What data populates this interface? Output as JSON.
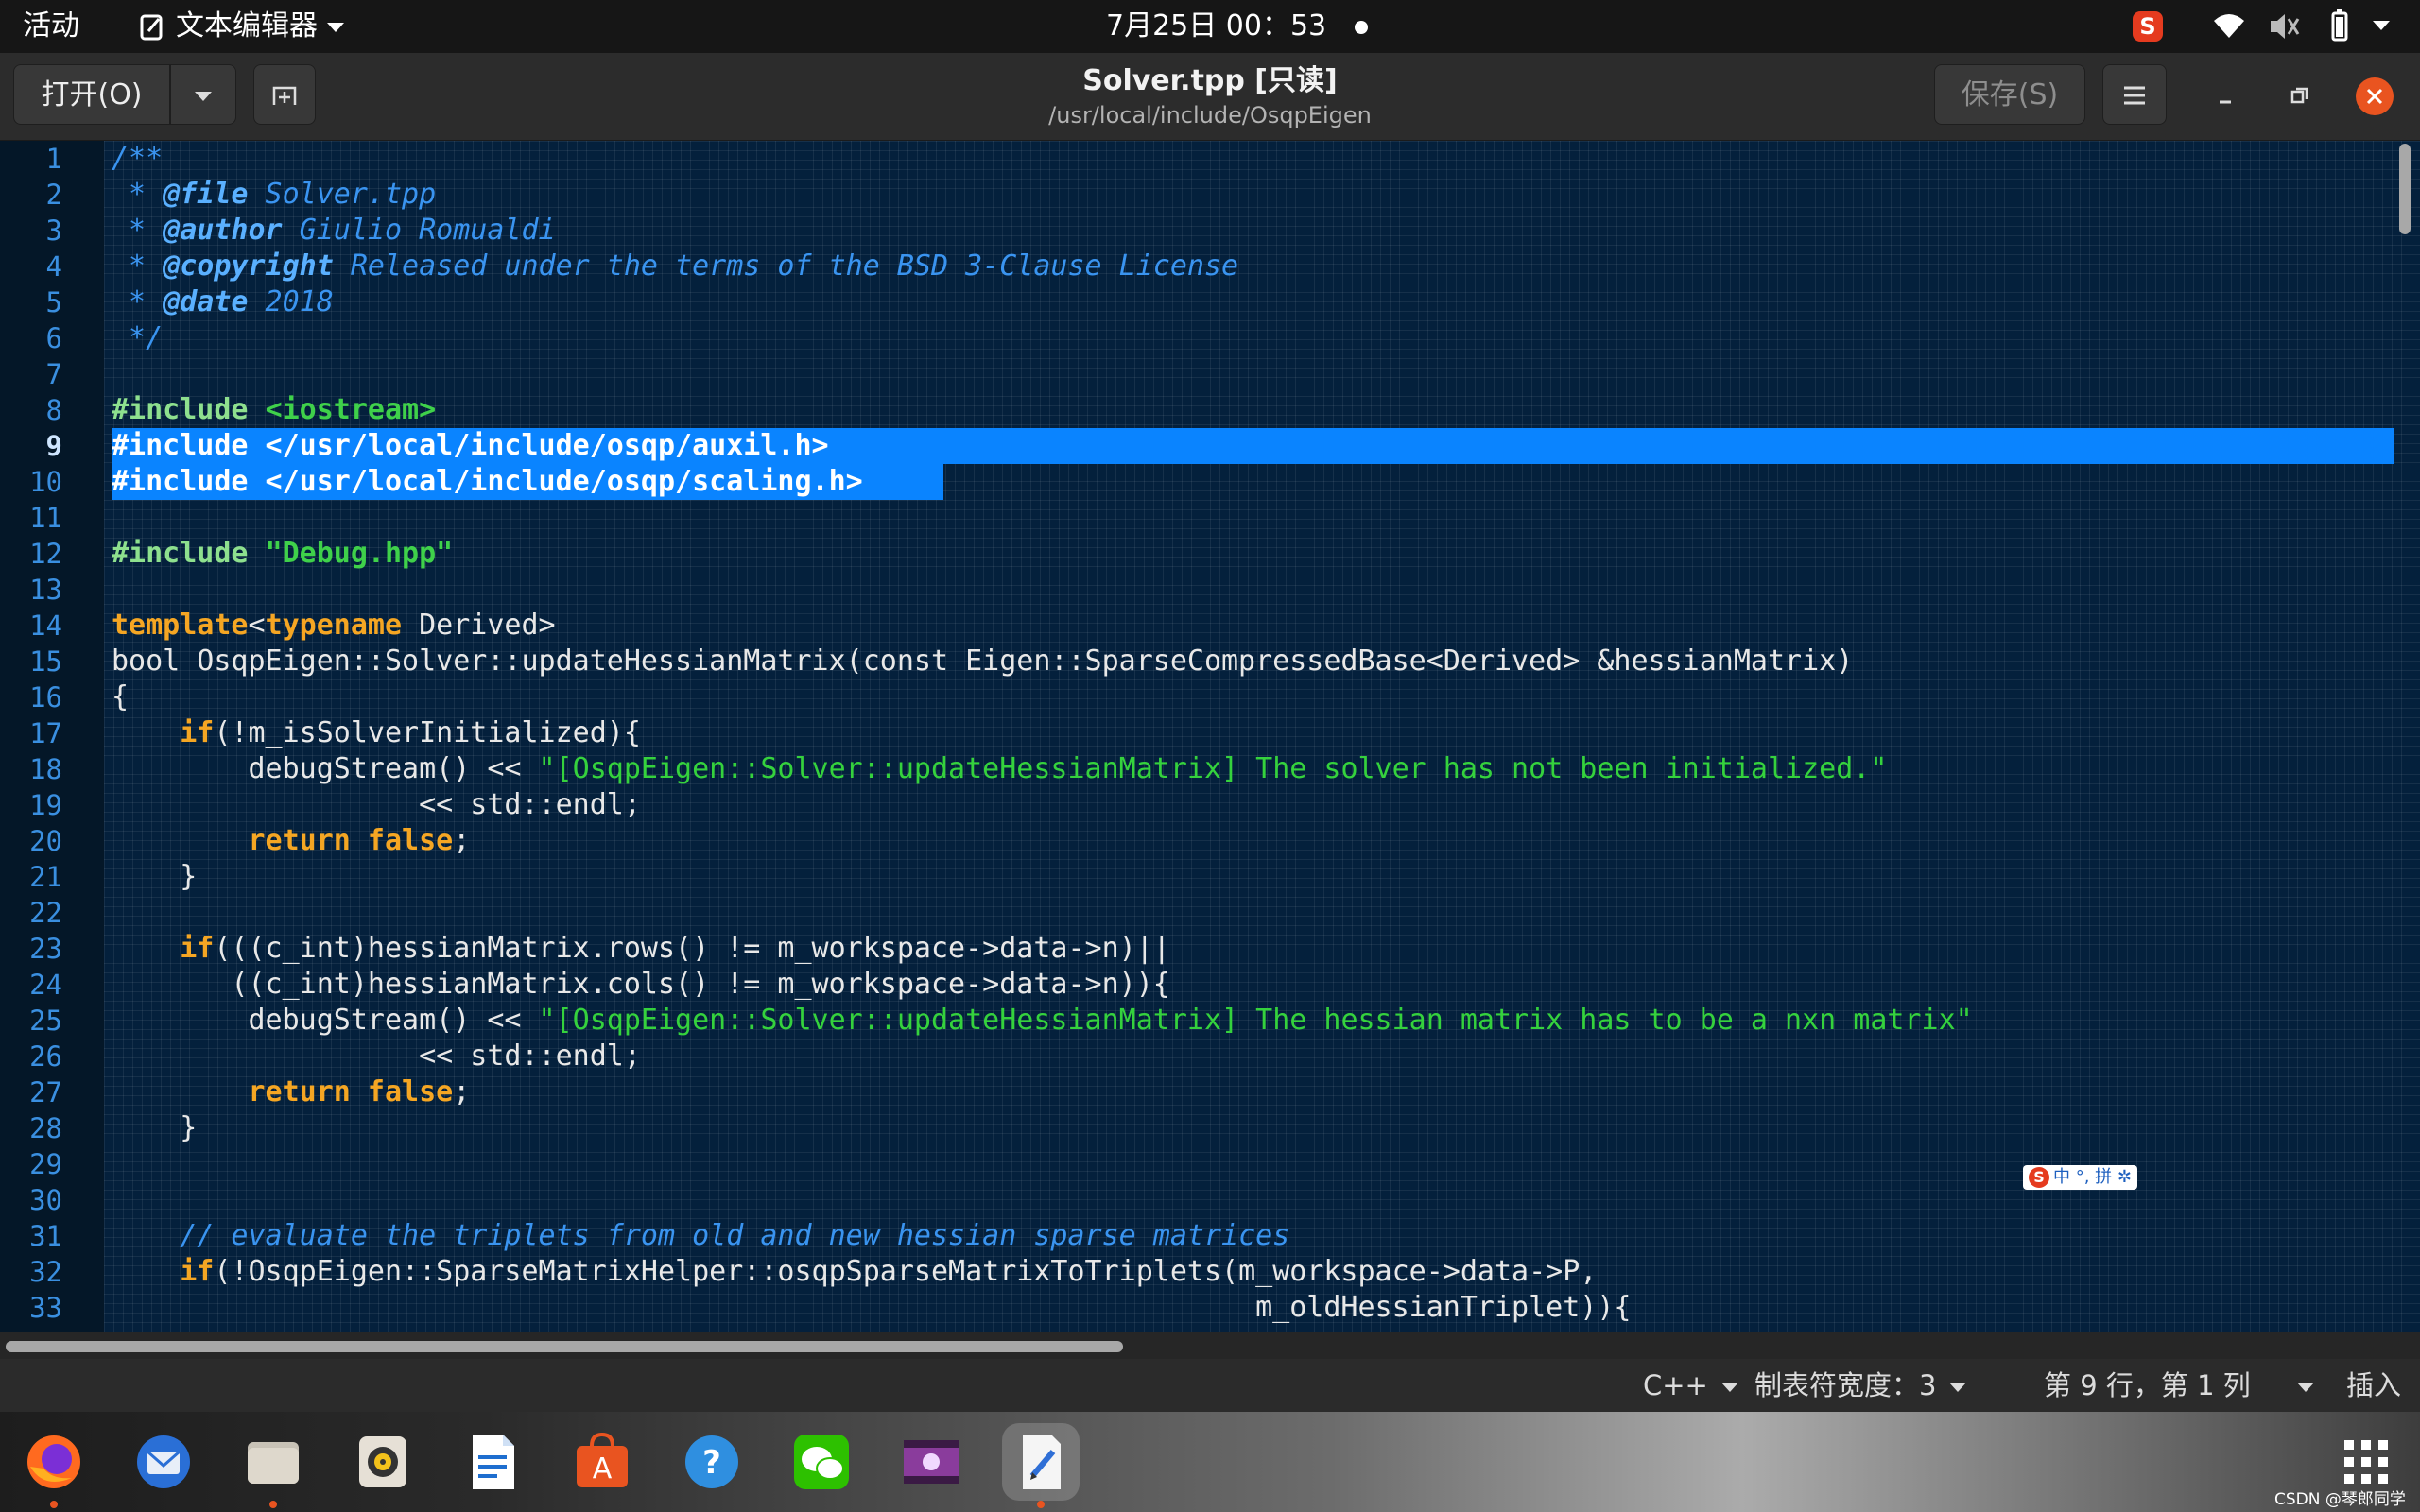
{
  "topbar": {
    "activities": "活动",
    "app_name": "文本编辑器",
    "clock": "7月25日  00：53",
    "ime_icon": "S"
  },
  "header": {
    "open_label": "打开(O)",
    "save_label": "保存(S)",
    "title": "Solver.tpp [只读]",
    "path": "/usr/local/include/OsqpEigen"
  },
  "editor": {
    "current_line": 9,
    "lines": [
      [
        {
          "c": "cm",
          "t": "/**"
        }
      ],
      [
        {
          "c": "cm",
          "t": " * "
        },
        {
          "c": "doctag",
          "t": "@file"
        },
        {
          "c": "cm",
          "t": " Solver.tpp"
        }
      ],
      [
        {
          "c": "cm",
          "t": " * "
        },
        {
          "c": "doctag",
          "t": "@author"
        },
        {
          "c": "cm",
          "t": " Giulio Romualdi"
        }
      ],
      [
        {
          "c": "cm",
          "t": " * "
        },
        {
          "c": "doctag",
          "t": "@copyright"
        },
        {
          "c": "cm",
          "t": " Released under the terms of the BSD 3-Clause License"
        }
      ],
      [
        {
          "c": "cm",
          "t": " * "
        },
        {
          "c": "doctag",
          "t": "@date"
        },
        {
          "c": "cm",
          "t": " 2018"
        }
      ],
      [
        {
          "c": "cm",
          "t": " */"
        }
      ],
      [],
      [
        {
          "c": "pp",
          "t": "#include"
        },
        {
          "c": "",
          "t": " "
        },
        {
          "c": "inc",
          "t": "<iostream>"
        }
      ],
      [
        {
          "c": "sel",
          "t": "#include </usr/local/include/osqp/auxil.h>"
        }
      ],
      [
        {
          "c": "sel",
          "t": "#include </usr/local/include/osqp/scaling.h>"
        }
      ],
      [],
      [
        {
          "c": "pp",
          "t": "#include"
        },
        {
          "c": "",
          "t": " "
        },
        {
          "c": "inc",
          "t": "\"Debug.hpp\""
        }
      ],
      [],
      [
        {
          "c": "kw",
          "t": "template"
        },
        {
          "c": "",
          "t": "<"
        },
        {
          "c": "kw",
          "t": "typename"
        },
        {
          "c": "",
          "t": " Derived>"
        }
      ],
      [
        {
          "c": "",
          "t": "bool OsqpEigen::Solver::updateHessianMatrix(const Eigen::SparseCompressedBase<Derived> &hessianMatrix)"
        }
      ],
      [
        {
          "c": "",
          "t": "{"
        }
      ],
      [
        {
          "c": "",
          "t": "    "
        },
        {
          "c": "kw",
          "t": "if"
        },
        {
          "c": "",
          "t": "(!m_isSolverInitialized){"
        }
      ],
      [
        {
          "c": "",
          "t": "        debugStream() << "
        },
        {
          "c": "str",
          "t": "\"[OsqpEigen::Solver::updateHessianMatrix] The solver has not been initialized.\""
        }
      ],
      [
        {
          "c": "",
          "t": "                  << std::endl;"
        }
      ],
      [
        {
          "c": "",
          "t": "        "
        },
        {
          "c": "kw",
          "t": "return false"
        },
        {
          "c": "",
          "t": ";"
        }
      ],
      [
        {
          "c": "",
          "t": "    }"
        }
      ],
      [],
      [
        {
          "c": "",
          "t": "    "
        },
        {
          "c": "kw",
          "t": "if"
        },
        {
          "c": "",
          "t": "(((c_int)hessianMatrix.rows() != m_workspace->data->n)||"
        }
      ],
      [
        {
          "c": "",
          "t": "       ((c_int)hessianMatrix.cols() != m_workspace->data->n)){"
        }
      ],
      [
        {
          "c": "",
          "t": "        debugStream() << "
        },
        {
          "c": "str",
          "t": "\"[OsqpEigen::Solver::updateHessianMatrix] The hessian matrix has to be a nxn matrix\""
        }
      ],
      [
        {
          "c": "",
          "t": "                  << std::endl;"
        }
      ],
      [
        {
          "c": "",
          "t": "        "
        },
        {
          "c": "kw",
          "t": "return false"
        },
        {
          "c": "",
          "t": ";"
        }
      ],
      [
        {
          "c": "",
          "t": "    }"
        }
      ],
      [],
      [],
      [
        {
          "c": "",
          "t": "    "
        },
        {
          "c": "cm",
          "t": "// evaluate the triplets from old and new hessian sparse matrices"
        }
      ],
      [
        {
          "c": "",
          "t": "    "
        },
        {
          "c": "kw",
          "t": "if"
        },
        {
          "c": "",
          "t": "(!OsqpEigen::SparseMatrixHelper::osqpSparseMatrixToTriplets(m_workspace->data->P,"
        }
      ],
      [
        {
          "c": "",
          "t": "                                                                   m_oldHessianTriplet)){"
        }
      ]
    ]
  },
  "ime_float": {
    "icon": "S",
    "text": "中 °, 拼 ✲"
  },
  "status": {
    "language": "C++",
    "tab_width": "制表符宽度：3",
    "cursor_position": "第 9 行，第 1 列",
    "insert_mode": "插入"
  },
  "dock": {
    "items": [
      {
        "name": "firefox",
        "running": true
      },
      {
        "name": "thunderbird",
        "running": false
      },
      {
        "name": "files",
        "running": true
      },
      {
        "name": "rhythmbox",
        "running": false
      },
      {
        "name": "libreoffice-writer",
        "running": false
      },
      {
        "name": "software-center",
        "running": false
      },
      {
        "name": "help",
        "running": false
      },
      {
        "name": "wechat",
        "running": false
      },
      {
        "name": "video",
        "running": false
      },
      {
        "name": "text-editor",
        "running": true
      }
    ],
    "watermark": "CSDN @琴郎同学"
  },
  "colors": {
    "editor_bg": "#04203c",
    "selection": "#0a84ff",
    "accent": "#e95420"
  }
}
